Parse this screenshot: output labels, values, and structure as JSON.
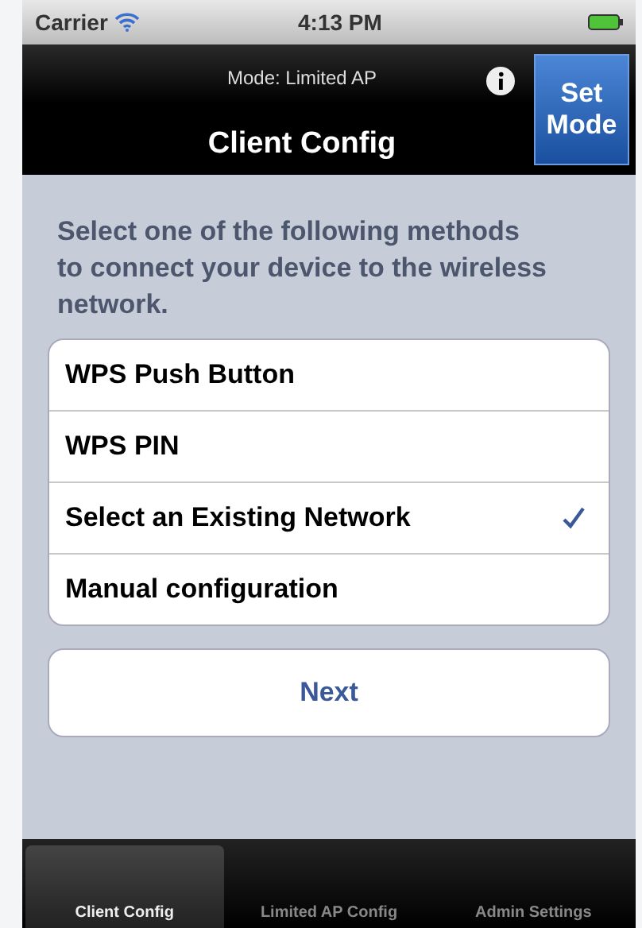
{
  "status_bar": {
    "carrier": "Carrier",
    "time": "4:13 PM"
  },
  "nav_bar": {
    "mode": "Mode: Limited AP",
    "title": "Client Config",
    "button": "Set Mode"
  },
  "instructions": "Select one of the following methods to connect your device to the wireless network.",
  "options": [
    {
      "label": "WPS Push Button",
      "selected": false
    },
    {
      "label": "WPS PIN",
      "selected": false
    },
    {
      "label": "Select an Existing Network",
      "selected": true
    },
    {
      "label": "Manual configuration",
      "selected": false
    }
  ],
  "next_button": "Next",
  "tabs": [
    {
      "label": "Client Config",
      "selected": true
    },
    {
      "label": "Limited AP Config",
      "selected": false
    },
    {
      "label": "Admin Settings",
      "selected": false
    }
  ]
}
